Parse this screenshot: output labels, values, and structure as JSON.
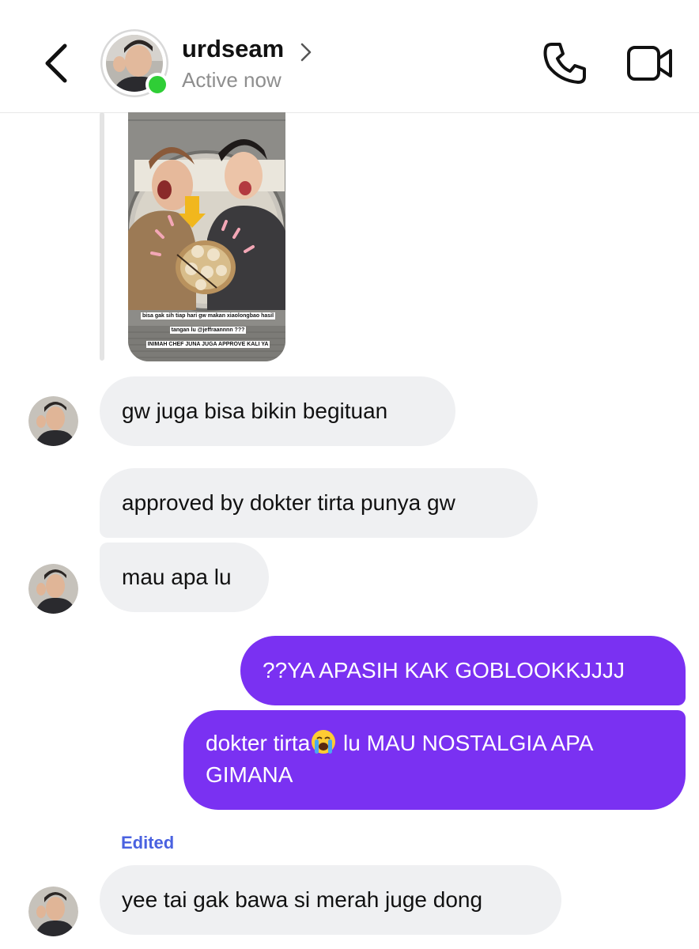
{
  "header": {
    "username": "urdseam",
    "status": "Active now",
    "icons": [
      "back-chevron-icon",
      "chevron-right-icon",
      "phone-icon",
      "video-camera-icon"
    ]
  },
  "story": {
    "caption_line1": "bisa gak sih tiap hari gw makan xiaolongbao hasil",
    "caption_line2": "tangan lu @jeffraannnn ???",
    "caption_line3": "INIMAH CHEF JUNA JUGA APPROVE KALI YA"
  },
  "messages": [
    {
      "side": "in",
      "text": "gw juga bisa bikin begituan"
    },
    {
      "side": "in",
      "text": "approved by dokter tirta punya gw"
    },
    {
      "side": "in",
      "text": "mau apa lu"
    },
    {
      "side": "out",
      "text": "??YA APASIH KAK GOBLOOKKJJJJ"
    },
    {
      "side": "out",
      "text_before_emoji": "dokter tirta",
      "emoji": "loudly-crying-face-emoji",
      "text_after_emoji": " lu MAU NOSTALGIA APA",
      "text_line2": "GIMANA"
    },
    {
      "side": "in",
      "text": "yee tai gak bawa si merah juge dong",
      "edited_label": "Edited"
    }
  ],
  "colors": {
    "outgoing_bubble": "#7a31f2",
    "incoming_bubble": "#eff0f2",
    "online_dot": "#2fce36",
    "edited_label": "#4a62e0",
    "status_text": "#8e8e8e"
  }
}
